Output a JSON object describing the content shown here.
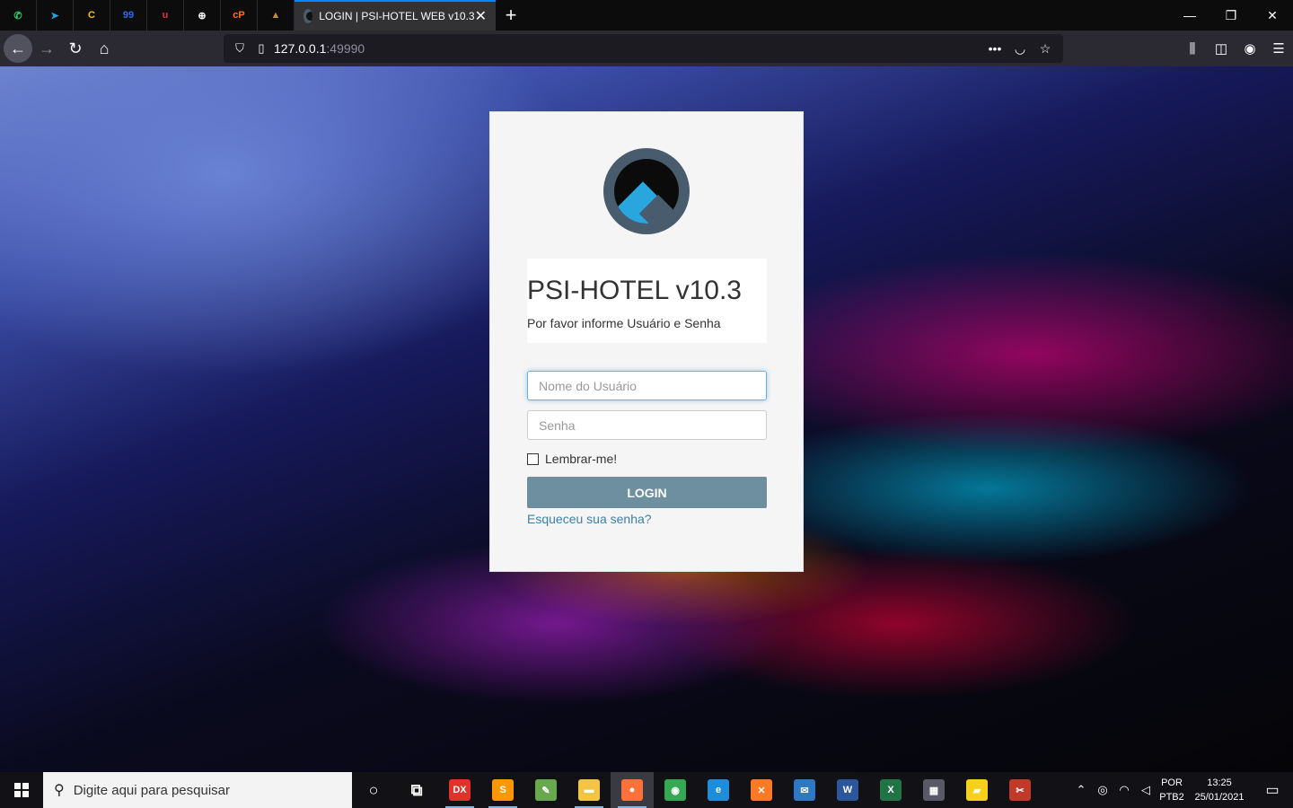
{
  "browser": {
    "pinned_tabs": [
      {
        "name": "whatsapp-tab",
        "glyph": "✆",
        "color": "#25d366"
      },
      {
        "name": "telegram-tab",
        "glyph": "➤",
        "color": "#2aa1da"
      },
      {
        "name": "c-app-tab",
        "glyph": "C",
        "color": "#f5c400"
      },
      {
        "name": "note-99-tab",
        "glyph": "99",
        "color": "#2d6be4"
      },
      {
        "name": "u-app-tab",
        "glyph": "u",
        "color": "#e52c3d"
      },
      {
        "name": "globe-tab",
        "glyph": "⊕",
        "color": "#ffffff"
      },
      {
        "name": "cpanel-tab",
        "glyph": "cP",
        "color": "#ff6c2c"
      },
      {
        "name": "psi-tab",
        "glyph": "▲",
        "color": "#c98b2f"
      }
    ],
    "active_tab_title": "LOGIN | PSI-HOTEL WEB v10.3",
    "url_host": "127.0.0.1",
    "url_port": ":49990"
  },
  "login": {
    "title": "PSI-HOTEL v10.3",
    "subtitle": "Por favor informe Usuário e Senha",
    "username_placeholder": "Nome do Usuário",
    "password_placeholder": "Senha",
    "remember_label": "Lembrar-me!",
    "login_button": "LOGIN",
    "forgot_link": "Esqueceu sua senha?"
  },
  "taskbar": {
    "search_placeholder": "Digite aqui para pesquisar",
    "apps": [
      {
        "name": "cortana-icon",
        "glyph": "○",
        "color": "transparent",
        "running": false
      },
      {
        "name": "task-view-icon",
        "glyph": "⧉",
        "color": "transparent",
        "running": false
      },
      {
        "name": "devexpress-icon",
        "glyph": "DX",
        "color": "#e0312b",
        "running": true
      },
      {
        "name": "sublime-icon",
        "glyph": "S",
        "color": "#ff9800",
        "running": true
      },
      {
        "name": "notepad-icon",
        "glyph": "✎",
        "color": "#6aa84f",
        "running": false
      },
      {
        "name": "file-explorer-icon",
        "glyph": "▬",
        "color": "#f4c542",
        "running": true
      },
      {
        "name": "firefox-icon",
        "glyph": "●",
        "color": "#ff7139",
        "running": true,
        "active": true
      },
      {
        "name": "chrome-icon",
        "glyph": "◉",
        "color": "#34a853",
        "running": false
      },
      {
        "name": "edge-icon",
        "glyph": "e",
        "color": "#1e8dd9",
        "running": false
      },
      {
        "name": "xampp-icon",
        "glyph": "✕",
        "color": "#fb7a24",
        "running": false
      },
      {
        "name": "mail-icon",
        "glyph": "✉",
        "color": "#2f78c4",
        "running": false
      },
      {
        "name": "word-icon",
        "glyph": "W",
        "color": "#2b579a",
        "running": false
      },
      {
        "name": "excel-icon",
        "glyph": "X",
        "color": "#217346",
        "running": false
      },
      {
        "name": "calculator-icon",
        "glyph": "▦",
        "color": "#5a5a66",
        "running": false
      },
      {
        "name": "sticky-notes-icon",
        "glyph": "▰",
        "color": "#f7d01c",
        "running": false
      },
      {
        "name": "snipping-icon",
        "glyph": "✂",
        "color": "#c0392b",
        "running": false
      }
    ],
    "language_top": "POR",
    "language_bottom": "PTB2",
    "time": "13:25",
    "date": "25/01/2021"
  }
}
